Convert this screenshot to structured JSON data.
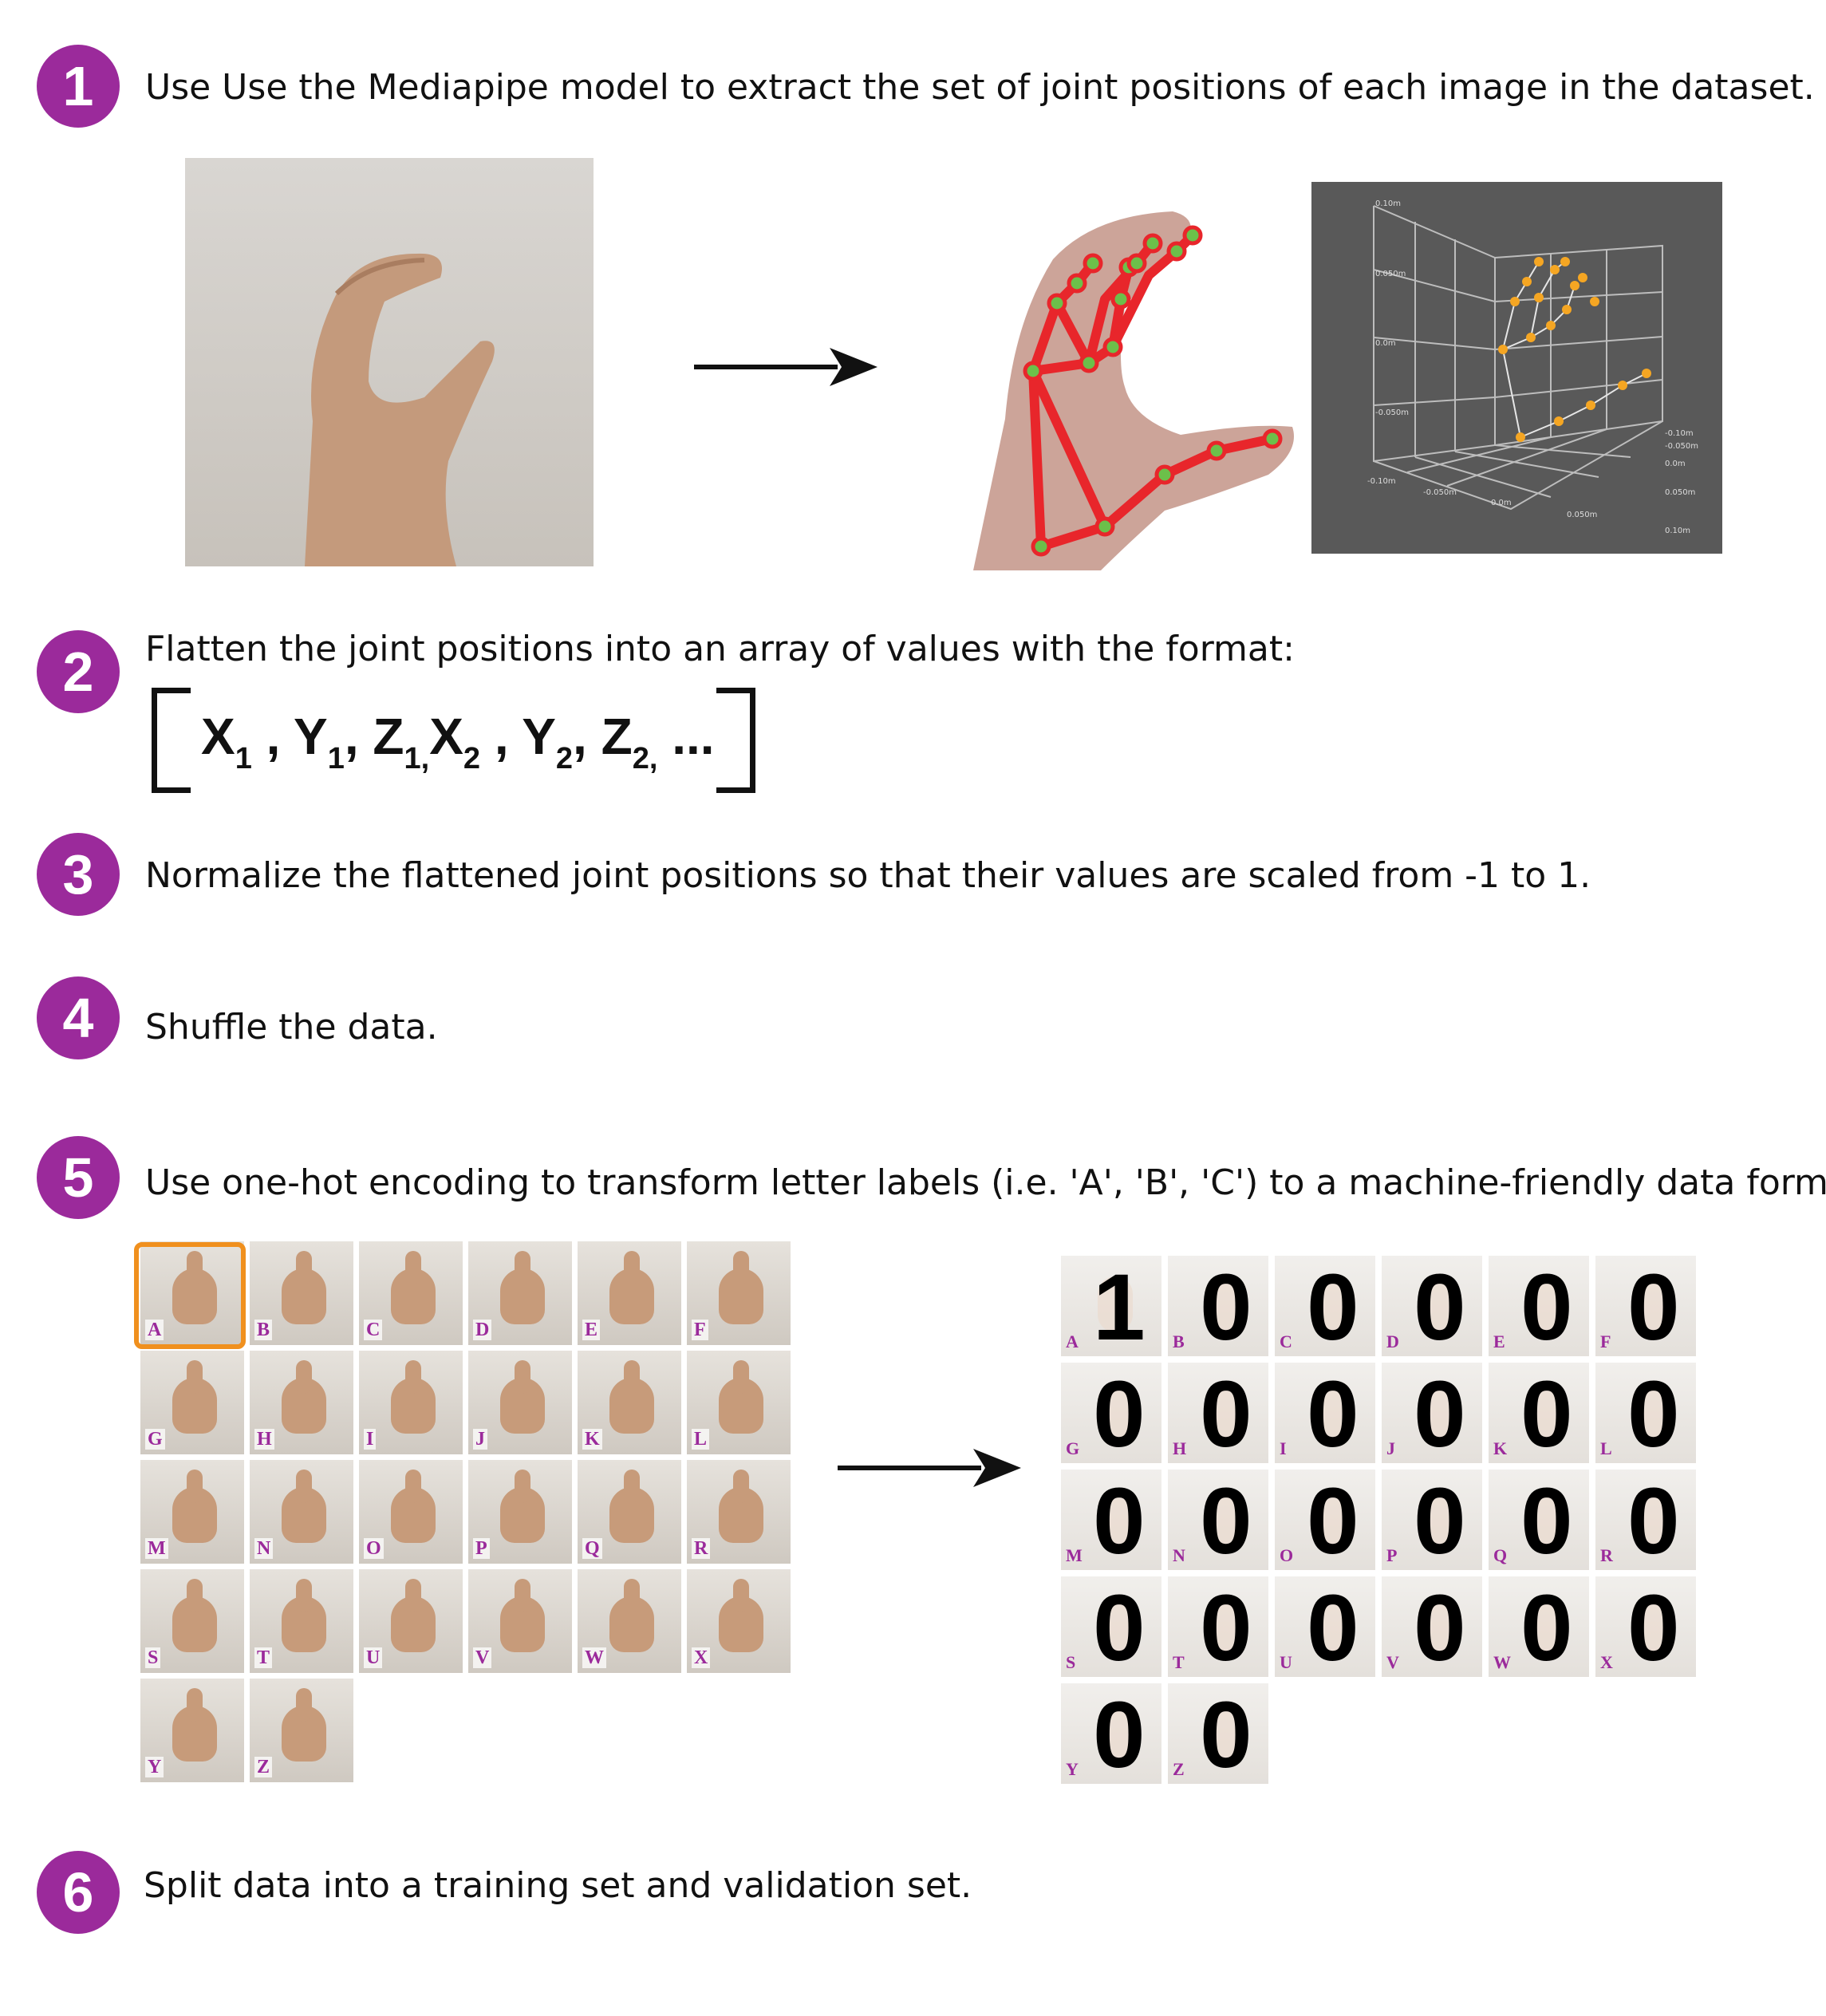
{
  "steps": [
    {
      "number": "1",
      "text": "Use Use the Mediapipe model to extract the set of joint positions of each image in the dataset."
    },
    {
      "number": "2",
      "text": "Flatten the joint positions into an array of values with the format:"
    },
    {
      "number": "3",
      "text": "Normalize the flattened joint positions so that their values are scaled from -1 to 1."
    },
    {
      "number": "4",
      "text": "Shuffle the data."
    },
    {
      "number": "5",
      "text": "Use one-hot encoding to transform letter labels (i.e. 'A', 'B', 'C') to a machine-friendly data format."
    },
    {
      "number": "6",
      "text": "Split data into a training set and validation set."
    }
  ],
  "formula": {
    "x1": "X",
    "x1_sub": "1",
    "y1": "Y",
    "y1_sub": "1",
    "z1": "Z",
    "z1_sub": "1,",
    "x2": "X",
    "x2_sub": "2",
    "y2": "Y",
    "y2_sub": "2",
    "z2": "Z",
    "z2_sub": "2,",
    "ellipsis": "..."
  },
  "plot3d": {
    "z_labels": [
      "0.10m",
      "0.050m",
      "0.0m",
      "-0.050m"
    ],
    "x_labels": [
      "-0.10m",
      "-0.050m",
      "0.0m",
      "0.050m"
    ],
    "y_labels": [
      "-0.10m",
      "-0.050m",
      "0.0m",
      "0.050m",
      "0.10m"
    ]
  },
  "letters": [
    "A",
    "B",
    "C",
    "D",
    "E",
    "F",
    "G",
    "H",
    "I",
    "J",
    "K",
    "L",
    "M",
    "N",
    "O",
    "P",
    "Q",
    "R",
    "S",
    "T",
    "U",
    "V",
    "W",
    "X",
    "Y",
    "Z"
  ],
  "one_hot": [
    "1",
    "0",
    "0",
    "0",
    "0",
    "0",
    "0",
    "0",
    "0",
    "0",
    "0",
    "0",
    "0",
    "0",
    "0",
    "0",
    "0",
    "0",
    "0",
    "0",
    "0",
    "0",
    "0",
    "0",
    "0",
    "0"
  ],
  "colors": {
    "accent": "#9b2a9b",
    "highlight": "#f0901e",
    "skeleton": "#e8262b",
    "joint": "#6cc04a",
    "plot_point": "#f5a623"
  }
}
